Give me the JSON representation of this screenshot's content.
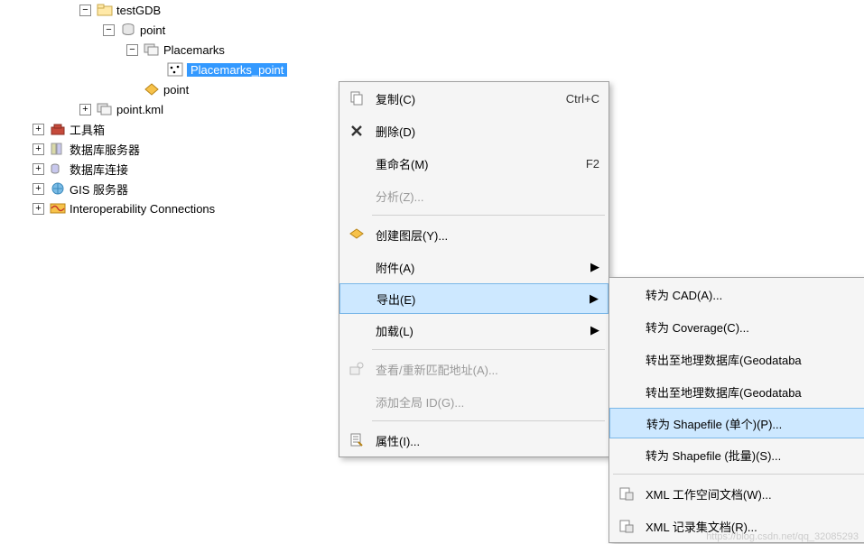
{
  "tree": {
    "testGDB": "testGDB",
    "point_ds": "point",
    "placemarks": "Placemarks",
    "placemarks_point": "Placemarks_point",
    "point_fc": "point",
    "point_kml": "point.kml",
    "toolbox": "工具箱",
    "db_servers": "数据库服务器",
    "db_connections": "数据库连接",
    "gis_servers": "GIS 服务器",
    "interop": "Interoperability Connections"
  },
  "menu": {
    "copy": "复制(C)",
    "copy_shortcut": "Ctrl+C",
    "delete": "删除(D)",
    "rename": "重命名(M)",
    "rename_shortcut": "F2",
    "analyze": "分析(Z)...",
    "create_layer": "创建图层(Y)...",
    "attachments": "附件(A)",
    "export": "导出(E)",
    "load": "加载(L)",
    "review_address": "查看/重新匹配地址(A)...",
    "add_global_id": "添加全局 ID(G)...",
    "properties": "属性(I)..."
  },
  "submenu": {
    "to_cad": "转为 CAD(A)...",
    "to_coverage": "转为 Coverage(C)...",
    "to_geodb1": "转出至地理数据库(Geodataba",
    "to_geodb2": "转出至地理数据库(Geodataba",
    "to_shapefile_single": "转为 Shapefile (单个)(P)...",
    "to_shapefile_batch": "转为 Shapefile (批量)(S)...",
    "xml_workspace": "XML 工作空间文档(W)...",
    "xml_recordset": "XML 记录集文档(R)..."
  },
  "watermark": "https://blog.csdn.net/qq_32085293"
}
